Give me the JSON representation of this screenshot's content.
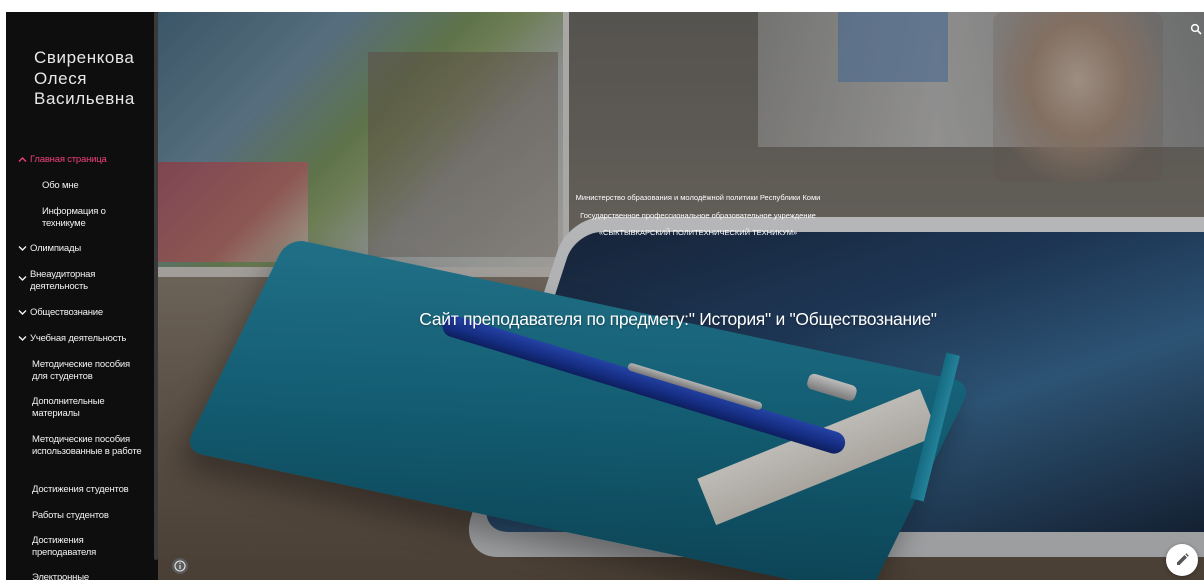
{
  "site": {
    "title": "Свиренкова Олеся Васильевна"
  },
  "nav": {
    "items": [
      {
        "label": "Главная страница",
        "icon": "chevron-up-icon",
        "active": true
      },
      {
        "label": "Обо мне"
      },
      {
        "label": "Информация о техникуме"
      },
      {
        "label": "Олимпиады",
        "icon": "chevron-down-icon"
      },
      {
        "label": "Внеаудиторная деятельность",
        "icon": "chevron-down-icon"
      },
      {
        "label": "Обществознание",
        "icon": "chevron-down-icon"
      },
      {
        "label": "Учебная деятельность",
        "icon": "chevron-down-icon"
      },
      {
        "label": "Методические пособия для студентов"
      },
      {
        "label": "Дополнительные материалы"
      },
      {
        "label": "Методические пособия использованные в работе"
      },
      {
        "label": "Достижения студентов"
      },
      {
        "label": "Работы студентов"
      },
      {
        "label": "Достижения преподавателя"
      },
      {
        "label": "Электронные"
      }
    ]
  },
  "hero": {
    "line1": "Министерство образования и молодёжной политики Республики Коми",
    "line2": "Государственное профессиональное образовательное учреждение",
    "line3": "«СЫКТЫВКАРСКИЙ ПОЛИТЕХНИЧЕСКИЙ ТЕХНИКУМ»",
    "title": "Сайт преподавателя по предмету:\" История\" и \"Обществознание\""
  },
  "colors": {
    "sidebar_bg": "#0e0e0e",
    "active_link": "#ef3f7e",
    "nav_text": "#f2f2f2"
  },
  "icons": {
    "search": "search-icon",
    "info": "info-icon",
    "edit": "pencil-icon"
  }
}
